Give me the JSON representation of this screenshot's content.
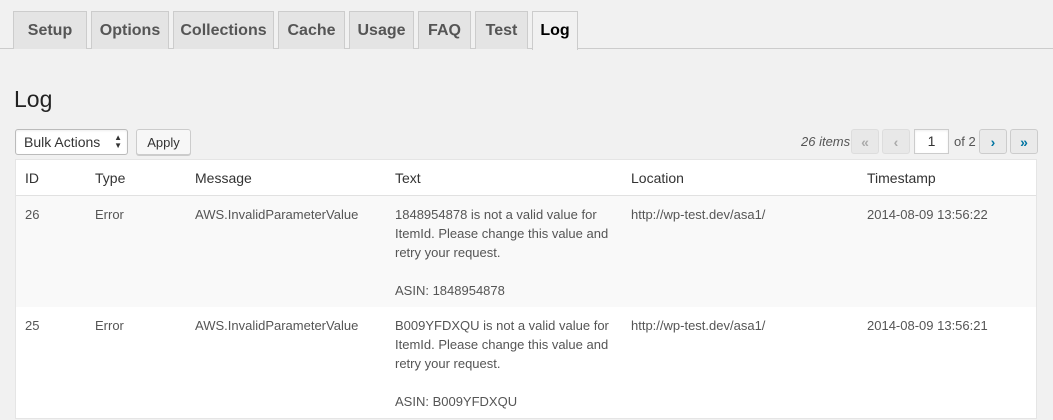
{
  "tabs": [
    "Setup",
    "Options",
    "Collections",
    "Cache",
    "Usage",
    "FAQ",
    "Test",
    "Log"
  ],
  "active_tab": "Log",
  "page_title": "Log",
  "bulk_actions": {
    "selected": "Bulk Actions",
    "apply_label": "Apply"
  },
  "pagination": {
    "items_count": "26 items",
    "first": "«",
    "prev": "‹",
    "next": "›",
    "last": "»",
    "current_page": "1",
    "of_pages": "of 2"
  },
  "table": {
    "columns": [
      "ID",
      "Type",
      "Message",
      "Text",
      "Location",
      "Timestamp"
    ],
    "rows": [
      {
        "id": "26",
        "type": "Error",
        "message": "AWS.InvalidParameterValue",
        "text": "1848954878 is not a valid value for ItemId. Please change this value and retry your request.",
        "asin": "ASIN: 1848954878",
        "location": "http://wp-test.dev/asa1/",
        "timestamp": "2014-08-09 13:56:22"
      },
      {
        "id": "25",
        "type": "Error",
        "message": "AWS.InvalidParameterValue",
        "text": "B009YFDXQU is not a valid value for ItemId. Please change this value and retry your request.",
        "asin": "ASIN: B009YFDXQU",
        "location": "http://wp-test.dev/asa1/",
        "timestamp": "2014-08-09 13:56:21"
      }
    ]
  }
}
